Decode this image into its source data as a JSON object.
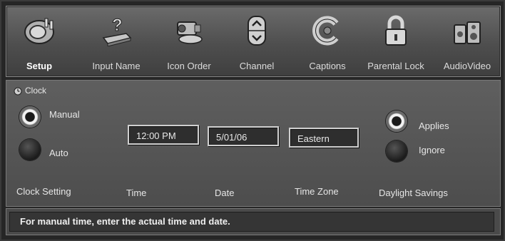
{
  "toolbar": {
    "items": [
      {
        "label": "Setup",
        "icon": "plug-icon",
        "active": true
      },
      {
        "label": "Input Name",
        "icon": "question-device-icon",
        "active": false
      },
      {
        "label": "Icon Order",
        "icon": "camcorder-icon",
        "active": false
      },
      {
        "label": "Channel",
        "icon": "channel-updown-icon",
        "active": false
      },
      {
        "label": "Captions",
        "icon": "captions-icon",
        "active": false
      },
      {
        "label": "Parental Lock",
        "icon": "padlock-icon",
        "active": false
      },
      {
        "label": "AudioVideo",
        "icon": "speakers-icon",
        "active": false
      }
    ]
  },
  "clock": {
    "section_label": "Clock",
    "mode_options": {
      "manual": "Manual",
      "auto": "Auto"
    },
    "selected_mode": "Manual",
    "time_value": "12:00 PM",
    "date_value": "5/01/06",
    "timezone_value": "Eastern",
    "daylight_options": {
      "applies": "Applies",
      "ignore": "Ignore"
    },
    "selected_daylight": "Applies",
    "captions": {
      "clock_setting": "Clock Setting",
      "time": "Time",
      "date": "Date",
      "time_zone": "Time Zone",
      "daylight_savings": "Daylight Savings"
    }
  },
  "status": {
    "message": "For manual time, enter the actual time and date."
  },
  "colors": {
    "panel": "#4d4d4d",
    "field_border": "#cfcfcf",
    "text": "#e6e6e6"
  }
}
